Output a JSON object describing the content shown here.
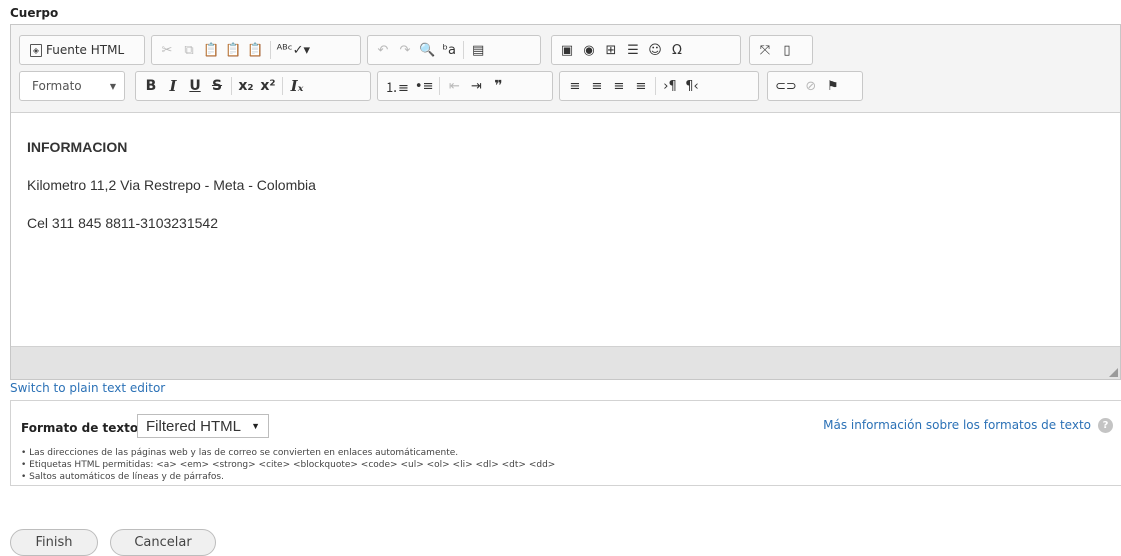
{
  "field_label": "Cuerpo",
  "toolbar": {
    "source_label": "Fuente HTML",
    "source_icon": "source-doc-icon",
    "row1_groups": [
      [
        {
          "name": "cut-icon",
          "glyph": "✂",
          "disabled": true
        },
        {
          "name": "copy-icon",
          "glyph": "⧉",
          "disabled": true
        },
        {
          "name": "paste-icon",
          "glyph": "📋",
          "disabled": false
        },
        {
          "name": "paste-text-icon",
          "glyph": "📋",
          "disabled": false
        },
        {
          "name": "paste-word-icon",
          "glyph": "📋",
          "disabled": false
        },
        {
          "sep": true
        },
        {
          "name": "spellcheck-icon",
          "glyph": "ᴬᴮᶜ✓▾",
          "disabled": false
        }
      ],
      [
        {
          "name": "undo-icon",
          "glyph": "↶",
          "disabled": true
        },
        {
          "name": "redo-icon",
          "glyph": "↷",
          "disabled": true
        },
        {
          "name": "find-icon",
          "glyph": "🔍",
          "disabled": false
        },
        {
          "name": "replace-icon",
          "glyph": "ᵇa",
          "disabled": false
        },
        {
          "sep": true
        },
        {
          "name": "select-all-icon",
          "glyph": "▤",
          "disabled": false
        }
      ],
      [
        {
          "name": "image-icon",
          "glyph": "▣",
          "disabled": false
        },
        {
          "name": "flash-icon",
          "glyph": "◉",
          "disabled": false
        },
        {
          "name": "table-icon",
          "glyph": "⊞",
          "disabled": false
        },
        {
          "name": "horizontal-rule-icon",
          "glyph": "☰",
          "disabled": false
        },
        {
          "name": "smiley-icon",
          "glyph": "☺",
          "disabled": false
        },
        {
          "name": "special-char-icon",
          "glyph": "Ω",
          "disabled": false
        }
      ],
      [
        {
          "name": "maximize-icon",
          "glyph": "⤧",
          "disabled": false
        },
        {
          "name": "show-blocks-icon",
          "glyph": "▯",
          "disabled": false
        }
      ]
    ],
    "format_label": "Formato",
    "row2_groups": [
      [
        {
          "name": "bold-icon",
          "glyph": "B",
          "cls": "bold"
        },
        {
          "name": "italic-icon",
          "glyph": "I",
          "cls": "ital"
        },
        {
          "name": "underline-icon",
          "glyph": "U",
          "cls": "under"
        },
        {
          "name": "strike-icon",
          "glyph": "S",
          "cls": "strike"
        },
        {
          "sep": true
        },
        {
          "name": "subscript-icon",
          "glyph": "x₂",
          "cls": "bold"
        },
        {
          "name": "superscript-icon",
          "glyph": "x²",
          "cls": "bold"
        },
        {
          "sep": true
        },
        {
          "name": "remove-format-icon",
          "glyph": "Iₓ",
          "cls": "ital"
        }
      ],
      [
        {
          "name": "numbered-list-icon",
          "glyph": "⒈≡"
        },
        {
          "name": "bulleted-list-icon",
          "glyph": "•≡"
        },
        {
          "sep": true
        },
        {
          "name": "outdent-icon",
          "glyph": "⇤",
          "disabled": true
        },
        {
          "name": "indent-icon",
          "glyph": "⇥"
        },
        {
          "name": "blockquote-icon",
          "glyph": "❞",
          "cls": "bold"
        }
      ],
      [
        {
          "name": "align-left-icon",
          "glyph": "≡"
        },
        {
          "name": "align-center-icon",
          "glyph": "≡"
        },
        {
          "name": "align-right-icon",
          "glyph": "≡"
        },
        {
          "name": "justify-icon",
          "glyph": "≡"
        },
        {
          "sep": true
        },
        {
          "name": "ltr-icon",
          "glyph": "›¶"
        },
        {
          "name": "rtl-icon",
          "glyph": "¶‹"
        }
      ],
      [
        {
          "name": "link-icon",
          "glyph": "⊂⊃"
        },
        {
          "name": "unlink-icon",
          "glyph": "⊘",
          "disabled": true
        },
        {
          "name": "anchor-flag-icon",
          "glyph": "⚑"
        }
      ]
    ]
  },
  "content": {
    "heading": "INFORMACION",
    "line1": "Kilometro 11,2 Via Restrepo - Meta - Colombia",
    "line2": "Cel 311 845 8811-3103231542"
  },
  "switch_link": "Switch to plain text editor",
  "text_format": {
    "label": "Formato de texto",
    "selected": "Filtered HTML",
    "more_link": "Más información sobre los formatos de texto",
    "help_icon": "help-icon",
    "tips": [
      "Las direcciones de las páginas web y las de correo se convierten en enlaces automáticamente.",
      "Etiquetas HTML permitidas: <a> <em> <strong> <cite> <blockquote> <code> <ul> <ol> <li> <dl> <dt> <dd>",
      "Saltos automáticos de líneas y de párrafos."
    ]
  },
  "actions": {
    "finish": "Finish",
    "cancel": "Cancelar"
  }
}
